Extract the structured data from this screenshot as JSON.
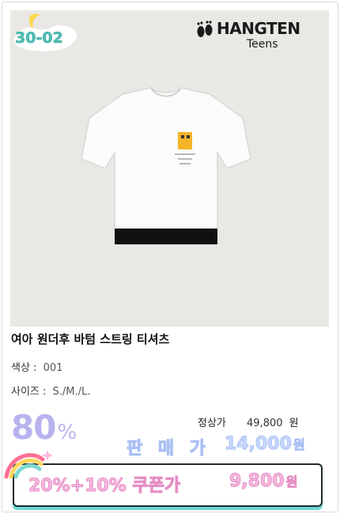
{
  "badge": {
    "code": "30-02",
    "icon": "moon-cloud-icon"
  },
  "brand": {
    "name": "HANGTEN",
    "sub": "Teens",
    "icon": "footprint-icon"
  },
  "product": {
    "title": "여아 원더후 바텀 스트링 티셔츠",
    "color_label": "색상 :",
    "color_value": "001",
    "size_label": "사이즈 :",
    "size_value": "S./M./L."
  },
  "price": {
    "discount": "80",
    "discount_unit": "%",
    "regular_label": "정상가",
    "regular_amount": "49,800",
    "won": "원",
    "sale_label": "판 매 가",
    "sale_amount": "14,000",
    "coupon_label": "20%+10% 쿠폰가",
    "coupon_amount": "9,800"
  },
  "colors": {
    "badge_teal": "#4dbdb3",
    "discount_lavender": "#b8b3ef",
    "sale_blue": "#c8d8ff",
    "coupon_pink": "#f7b9df",
    "image_bg": "#e9e8e4"
  }
}
